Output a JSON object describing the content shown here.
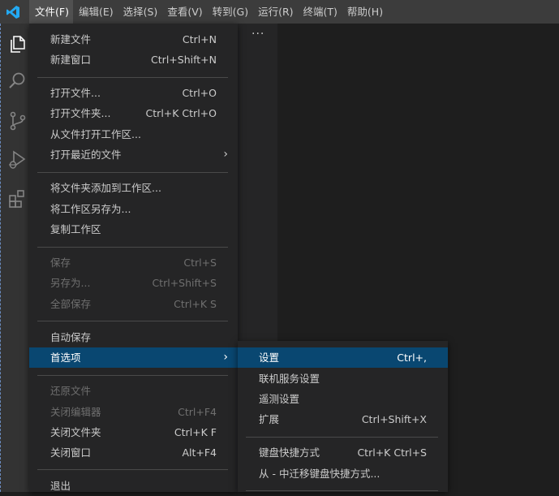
{
  "titlebar": {
    "menus": [
      {
        "label": "文件(F)"
      },
      {
        "label": "编辑(E)"
      },
      {
        "label": "选择(S)"
      },
      {
        "label": "查看(V)"
      },
      {
        "label": "转到(G)"
      },
      {
        "label": "运行(R)"
      },
      {
        "label": "终端(T)"
      },
      {
        "label": "帮助(H)"
      }
    ]
  },
  "activity_bar": {
    "icons": [
      "explorer-icon",
      "search-icon",
      "source-control-icon",
      "run-debug-icon",
      "extensions-icon"
    ]
  },
  "sidebar": {
    "more_label": "···"
  },
  "file_menu": {
    "new_file": {
      "label": "新建文件",
      "shortcut": "Ctrl+N"
    },
    "new_window": {
      "label": "新建窗口",
      "shortcut": "Ctrl+Shift+N"
    },
    "open_file": {
      "label": "打开文件...",
      "shortcut": "Ctrl+O"
    },
    "open_folder": {
      "label": "打开文件夹...",
      "shortcut": "Ctrl+K Ctrl+O"
    },
    "open_workspace": {
      "label": "从文件打开工作区..."
    },
    "open_recent": {
      "label": "打开最近的文件",
      "arrow": "›"
    },
    "add_folder": {
      "label": "将文件夹添加到工作区..."
    },
    "save_workspace_as": {
      "label": "将工作区另存为..."
    },
    "duplicate_workspace": {
      "label": "复制工作区"
    },
    "save": {
      "label": "保存",
      "shortcut": "Ctrl+S"
    },
    "save_as": {
      "label": "另存为...",
      "shortcut": "Ctrl+Shift+S"
    },
    "save_all": {
      "label": "全部保存",
      "shortcut": "Ctrl+K S"
    },
    "auto_save": {
      "label": "自动保存"
    },
    "preferences": {
      "label": "首选项",
      "arrow": "›"
    },
    "revert_file": {
      "label": "还原文件"
    },
    "close_editor": {
      "label": "关闭编辑器",
      "shortcut": "Ctrl+F4"
    },
    "close_folder": {
      "label": "关闭文件夹",
      "shortcut": "Ctrl+K F"
    },
    "close_window": {
      "label": "关闭窗口",
      "shortcut": "Alt+F4"
    },
    "exit": {
      "label": "退出"
    }
  },
  "preferences_menu": {
    "settings": {
      "label": "设置",
      "shortcut": "Ctrl+,"
    },
    "online_services": {
      "label": "联机服务设置"
    },
    "telemetry": {
      "label": "遥测设置"
    },
    "extensions": {
      "label": "扩展",
      "shortcut": "Ctrl+Shift+X"
    },
    "keyboard_shortcuts": {
      "label": "键盘快捷方式",
      "shortcut": "Ctrl+K Ctrl+S"
    },
    "migrate_keybindings": {
      "label": "从 - 中迁移键盘快捷方式..."
    }
  },
  "colors": {
    "accent": "#094771",
    "titlebar": "#3c3c3c",
    "menu_bg": "#252526",
    "logo": "#23a9f2"
  }
}
